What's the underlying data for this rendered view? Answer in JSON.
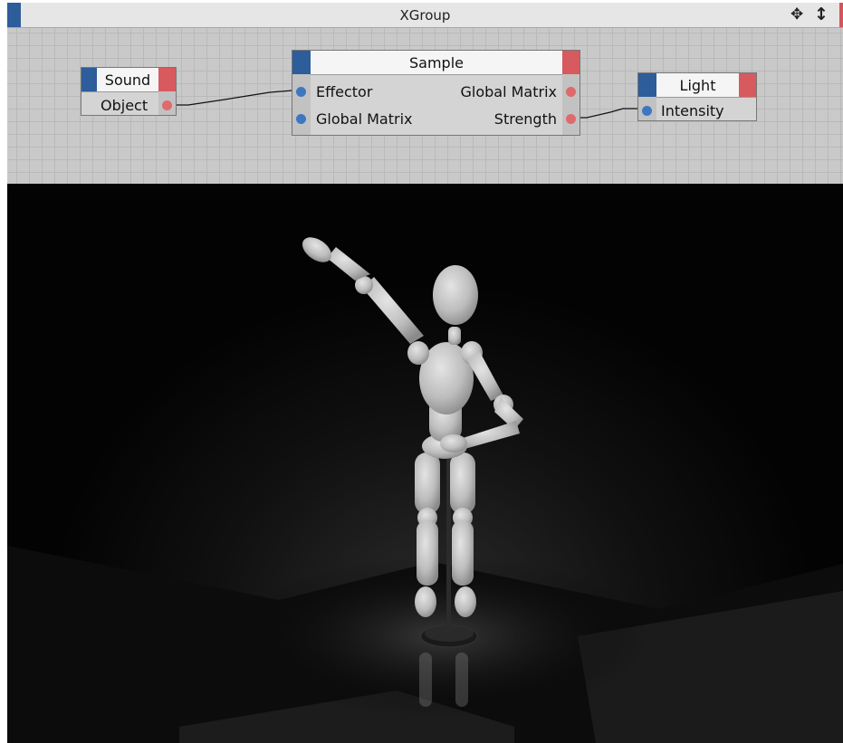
{
  "window": {
    "title": "XGroup"
  },
  "toolbar_icons": [
    "move-icon",
    "vertical-arrow-icon"
  ],
  "nodes": {
    "sound": {
      "title": "Sound",
      "outputs": [
        "Object"
      ]
    },
    "sample": {
      "title": "Sample",
      "inputs": [
        "Effector",
        "Global Matrix"
      ],
      "outputs": [
        "Global Matrix",
        "Strength"
      ]
    },
    "light": {
      "title": "Light",
      "inputs": [
        "Intensity"
      ]
    }
  },
  "colors": {
    "node_input_port": "#3e77c1",
    "node_output_port": "#df6a6d",
    "title_accent_blue": "#2d5d9a",
    "title_accent_red": "#d65a5e",
    "grid_bg": "#c9c9c9",
    "viewport_bg": "#000000"
  },
  "viewport": {
    "subject": "wooden-mannequin-figure-with-microphone-stand"
  }
}
